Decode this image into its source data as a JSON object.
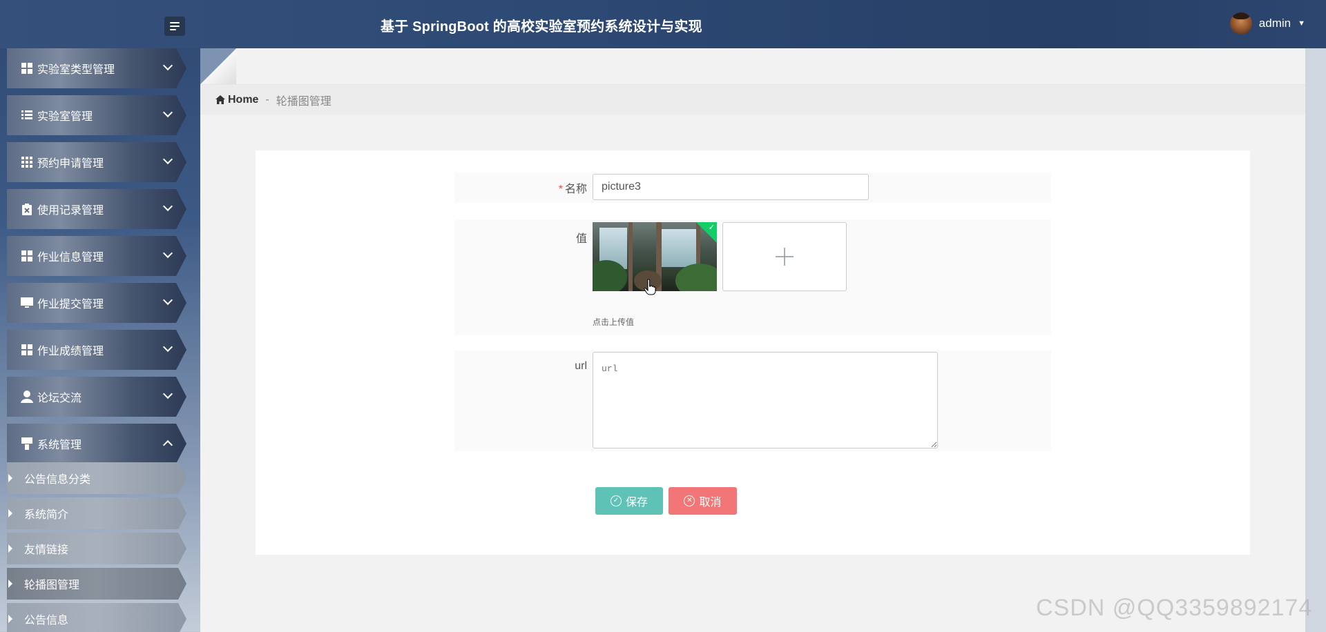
{
  "header": {
    "title": "基于 SpringBoot 的高校实验室预约系统设计与实现",
    "user_name": "admin",
    "menu_toggle_icon": "menu-toggle-icon"
  },
  "sidebar": {
    "items": [
      {
        "label": "实验室类型管理",
        "icon": "grid-icon",
        "expanded": false
      },
      {
        "label": "实验室管理",
        "icon": "list-icon",
        "expanded": false
      },
      {
        "label": "预约申请管理",
        "icon": "apps-icon",
        "expanded": false
      },
      {
        "label": "使用记录管理",
        "icon": "clipboard-icon",
        "expanded": false
      },
      {
        "label": "作业信息管理",
        "icon": "grid-icon",
        "expanded": false
      },
      {
        "label": "作业提交管理",
        "icon": "monitor-icon",
        "expanded": false
      },
      {
        "label": "作业成绩管理",
        "icon": "grid-icon",
        "expanded": false
      },
      {
        "label": "论坛交流",
        "icon": "user-icon",
        "expanded": false
      },
      {
        "label": "系统管理",
        "icon": "brush-icon",
        "expanded": true
      }
    ],
    "sub_items": [
      {
        "label": "公告信息分类",
        "active": false
      },
      {
        "label": "系统简介",
        "active": false
      },
      {
        "label": "友情链接",
        "active": false
      },
      {
        "label": "轮播图管理",
        "active": true
      },
      {
        "label": "公告信息",
        "active": false
      }
    ]
  },
  "breadcrumb": {
    "home": "Home",
    "separator": "-",
    "current": "轮播图管理"
  },
  "form": {
    "name_label": "名称",
    "name_required_mark": "*",
    "name_value": "picture3",
    "value_label": "值",
    "upload_hint": "点击上传值",
    "url_label": "url",
    "url_placeholder": "url",
    "url_value": ""
  },
  "buttons": {
    "save": "保存",
    "cancel": "取消"
  },
  "watermark": "CSDN @QQ3359892174",
  "colors": {
    "save_button": "#5fc2b6",
    "cancel_button": "#f27677",
    "required_mark": "#e84c3d",
    "upload_success": "#13ce66"
  }
}
